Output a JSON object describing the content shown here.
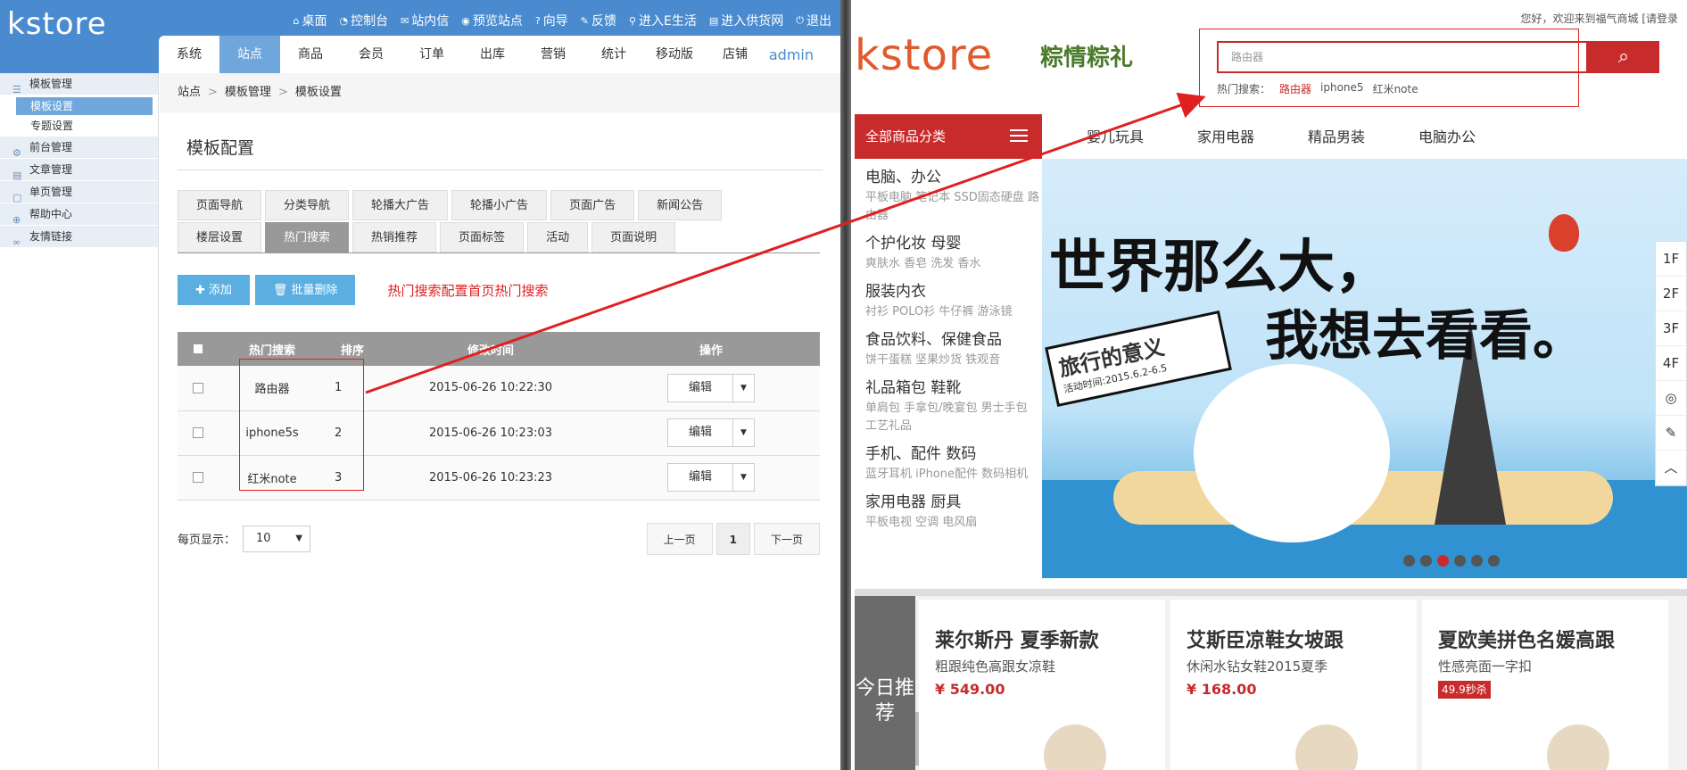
{
  "admin": {
    "logo": "kstore",
    "top_links": [
      {
        "icon": "home-icon",
        "glyph": "⌂",
        "label": "桌面"
      },
      {
        "icon": "dashboard-icon",
        "glyph": "◔",
        "label": "控制台"
      },
      {
        "icon": "mail-icon",
        "glyph": "✉",
        "label": "站内信"
      },
      {
        "icon": "eye-icon",
        "glyph": "◉",
        "label": "预览站点"
      },
      {
        "icon": "help-icon",
        "glyph": "?",
        "label": "向导"
      },
      {
        "icon": "edit-icon",
        "glyph": "✎",
        "label": "反馈"
      },
      {
        "icon": "link-icon",
        "glyph": "⚲",
        "label": "进入E生活"
      },
      {
        "icon": "shop-icon",
        "glyph": "▤",
        "label": "进入供货网"
      },
      {
        "icon": "power-icon",
        "glyph": "⏻",
        "label": "退出"
      }
    ],
    "nav": [
      "系统",
      "站点",
      "商品",
      "会员",
      "订单",
      "出库",
      "营销",
      "统计",
      "移动版",
      "店铺"
    ],
    "admin_name": "admin",
    "sidebar": [
      {
        "label": "模板管理",
        "icon": "list-icon",
        "glyph": "☰",
        "children": [
          {
            "label": "模板设置",
            "active": true
          },
          {
            "label": "专题设置",
            "active": false
          }
        ]
      },
      {
        "label": "前台管理",
        "icon": "gear-icon",
        "glyph": "⚙",
        "children": []
      },
      {
        "label": "文章管理",
        "icon": "article-icon",
        "glyph": "▤",
        "children": []
      },
      {
        "label": "单页管理",
        "icon": "page-icon",
        "glyph": "▢",
        "children": []
      },
      {
        "label": "帮助中心",
        "icon": "help-icon",
        "glyph": "⊕",
        "children": []
      },
      {
        "label": "友情链接",
        "icon": "link-icon",
        "glyph": "∞",
        "children": []
      }
    ],
    "breadcrumb": [
      "站点",
      "模板管理",
      "模板设置"
    ],
    "panel_title": "模板配置",
    "tabs_row1": [
      "页面导航",
      "分类导航",
      "轮播大广告",
      "轮播小广告",
      "页面广告",
      "新闻公告"
    ],
    "tabs_row2": [
      "楼层设置",
      "热门搜索",
      "热销推荐",
      "页面标签",
      "活动",
      "页面说明"
    ],
    "active_tab": "热门搜索",
    "add_button": "添加",
    "batch_delete_button": "批量删除",
    "note": "热门搜索配置首页热门搜索",
    "table": {
      "headers": [
        "热门搜索",
        "排序",
        "修改时间",
        "操作"
      ],
      "rows": [
        {
          "keyword": "路由器",
          "order": "1",
          "time": "2015-06-26 10:22:30",
          "op": "编辑"
        },
        {
          "keyword": "iphone5s",
          "order": "2",
          "time": "2015-06-26 10:23:03",
          "op": "编辑"
        },
        {
          "keyword": "红米note",
          "order": "3",
          "time": "2015-06-26 10:23:23",
          "op": "编辑"
        }
      ]
    },
    "page_size_label": "每页显示：",
    "page_size": "10",
    "pager": {
      "prev": "上一页",
      "current": "1",
      "next": "下一页"
    }
  },
  "store": {
    "welcome": "您好，欢迎来到福气商城 [请登录",
    "logo": "kstore",
    "brand2": "粽情粽礼",
    "search_placeholder": "路由器",
    "hot_label": "热门搜索：",
    "hot_items": [
      "路由器",
      "iphone5",
      "红米note"
    ],
    "cat_title": "全部商品分类",
    "top_nav": [
      "婴儿玩具",
      "家用电器",
      "精品男装",
      "电脑办公"
    ],
    "categories": [
      {
        "main": "电脑、办公",
        "sub": "平板电脑  笔记本  SSD固态硬盘  路由器"
      },
      {
        "main": "个护化妆  母婴",
        "sub": "爽肤水  香皂  洗发  香水"
      },
      {
        "main": "服装内衣",
        "sub": "衬衫  POLO衫  牛仔裤  游泳镜"
      },
      {
        "main": "食品饮料、保健食品",
        "sub": "饼干蛋糕  坚果炒货  铁观音"
      },
      {
        "main": "礼品箱包  鞋靴",
        "sub": "单肩包  手拿包/晚宴包  男士手包  工艺礼品"
      },
      {
        "main": "手机、配件  数码",
        "sub": "蓝牙耳机  iPhone配件  数码相机"
      },
      {
        "main": "家用电器  厨具",
        "sub": "平板电视  空调  电风扇"
      }
    ],
    "banner": {
      "line1": "世界那么大，",
      "line2": "我想去看看。",
      "stamp_title": "旅行的意义",
      "stamp_sub": "活动时间:2015.6.2-6.5",
      "active_dot": 3
    },
    "floors": [
      "1F",
      "2F",
      "3F",
      "4F"
    ],
    "today_tag": "今日推荐",
    "products": [
      {
        "title": "莱尔斯丹 夏季新款",
        "sub": "粗跟纯色高跟女凉鞋",
        "price": "¥ 549.00"
      },
      {
        "title": "艾斯臣凉鞋女坡跟",
        "sub": "休闲水钻女鞋2015夏季",
        "price": "¥ 168.00"
      },
      {
        "title": "夏欧美拼色名媛高跟",
        "sub": "性感亮面一字扣",
        "badge": "49.9秒杀"
      }
    ]
  }
}
